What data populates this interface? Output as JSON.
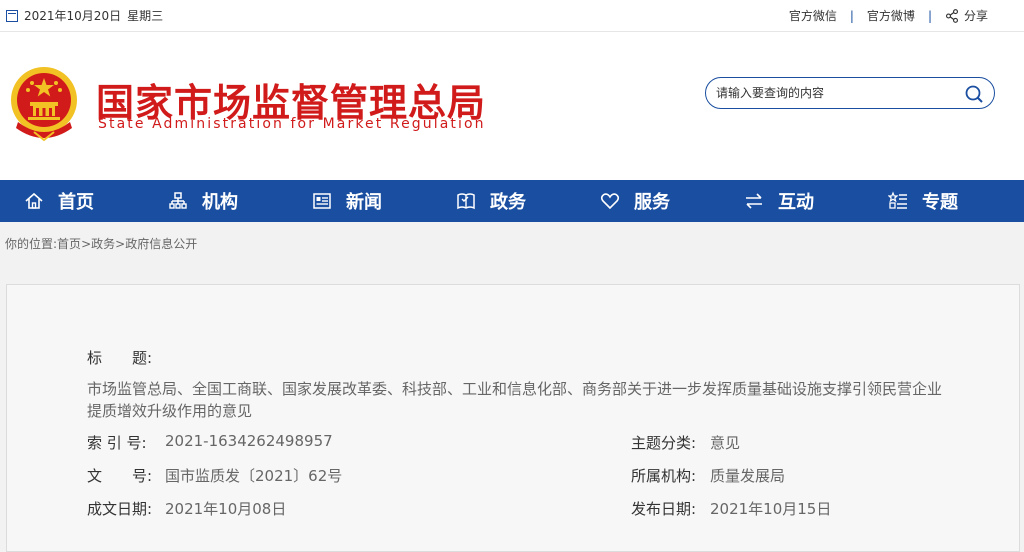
{
  "topbar": {
    "date": "2021年10月20日",
    "weekday": "星期三",
    "links": [
      "官方微信",
      "官方微博"
    ],
    "share": "分享"
  },
  "header": {
    "title_cn": "国家市场监督管理总局",
    "title_en": "State Administration for Market Regulation",
    "search_placeholder": "请输入要查询的内容"
  },
  "nav": {
    "items": [
      {
        "label": "首页",
        "icon": "home-icon"
      },
      {
        "label": "机构",
        "icon": "org-chart-icon"
      },
      {
        "label": "新闻",
        "icon": "news-icon"
      },
      {
        "label": "政务",
        "icon": "book-icon"
      },
      {
        "label": "服务",
        "icon": "heart-icon"
      },
      {
        "label": "互动",
        "icon": "exchange-arrows-icon"
      },
      {
        "label": "专题",
        "icon": "topic-icon"
      }
    ]
  },
  "breadcrumb": {
    "prefix": "你的位置:",
    "items": [
      "首页",
      "政务",
      "政府信息公开"
    ],
    "separator": ">"
  },
  "document": {
    "title_label": "标　　题:",
    "title_value": "市场监管总局、全国工商联、国家发展改革委、科技部、工业和信息化部、商务部关于进一步发挥质量基础设施支撑引领民营企业提质增效升级作用的意见",
    "index_label": "索 引 号:",
    "index_value": "2021-1634262498957",
    "doc_no_label": "文　　号:",
    "doc_no_value": "国市监质发〔2021〕62号",
    "created_label": "成文日期:",
    "created_value": "2021年10月08日",
    "topic_label": "主题分类:",
    "topic_value": "意见",
    "org_label": "所属机构:",
    "org_value": "质量发展局",
    "published_label": "发布日期:",
    "published_value": "2021年10月15日"
  },
  "colors": {
    "primary_blue": "#1a4ea0",
    "brand_red": "#d11b1b"
  }
}
